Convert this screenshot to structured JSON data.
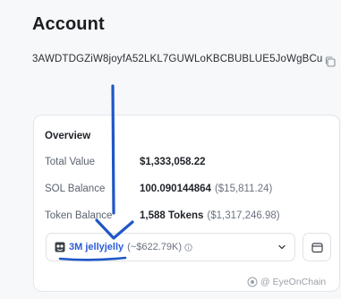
{
  "page": {
    "title": "Account"
  },
  "account": {
    "address": "3AWDTDGZiW8joyfA52LKL7GUWLoKBCBUBLUE5JoWgBCu"
  },
  "overview": {
    "title": "Overview",
    "rows": [
      {
        "label": "Total Value",
        "value": "$1,333,058.22",
        "sub": ""
      },
      {
        "label": "SOL Balance",
        "value": "100.090144864",
        "sub": "($15,811.24)"
      },
      {
        "label": "Token Balance",
        "value": "1,588 Tokens",
        "sub": "($1,317,246.98)"
      }
    ]
  },
  "token_select": {
    "name": "3M jellyjelly",
    "value": "(~$622.79K)"
  },
  "annotation": {
    "color": "#1f56c7"
  },
  "watermark": {
    "text": "@ EyeOnChain"
  },
  "colors": {
    "accent": "#2b5cd8"
  }
}
